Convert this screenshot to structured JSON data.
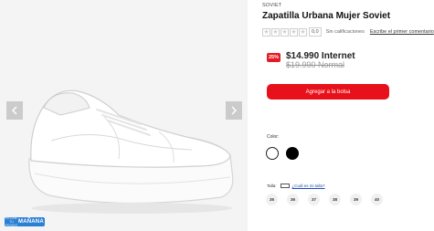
{
  "gallery": {
    "prev_icon": "chevron-left-icon",
    "next_icon": "chevron-right-icon",
    "badge": {
      "line1": "RECIBE TU PEDIDO",
      "line2": "MAÑANA"
    }
  },
  "product": {
    "brand": "SOVIET",
    "title": "Zapatilla Urbana Mujer Soviet",
    "rating": {
      "value": "0,0",
      "no_ratings": "Sin calificaciones",
      "write_review": "Escribe el primer comentario"
    },
    "discount": "25%",
    "price": "$14.990 Internet",
    "old_price": "$19.990 Normal",
    "add_to_cart": "Agregar a la bolsa",
    "color_label": "Color:",
    "colors": [
      {
        "name": "white",
        "hex": "#ffffff"
      },
      {
        "name": "black",
        "hex": "#000000"
      }
    ],
    "size_label": "Talla:",
    "size_guide": "¿Cuál es mi talla?",
    "sizes": [
      "35",
      "36",
      "37",
      "38",
      "39",
      "40"
    ]
  },
  "colors": {
    "accent": "#e8101a",
    "badge": "#2b7fd4"
  }
}
